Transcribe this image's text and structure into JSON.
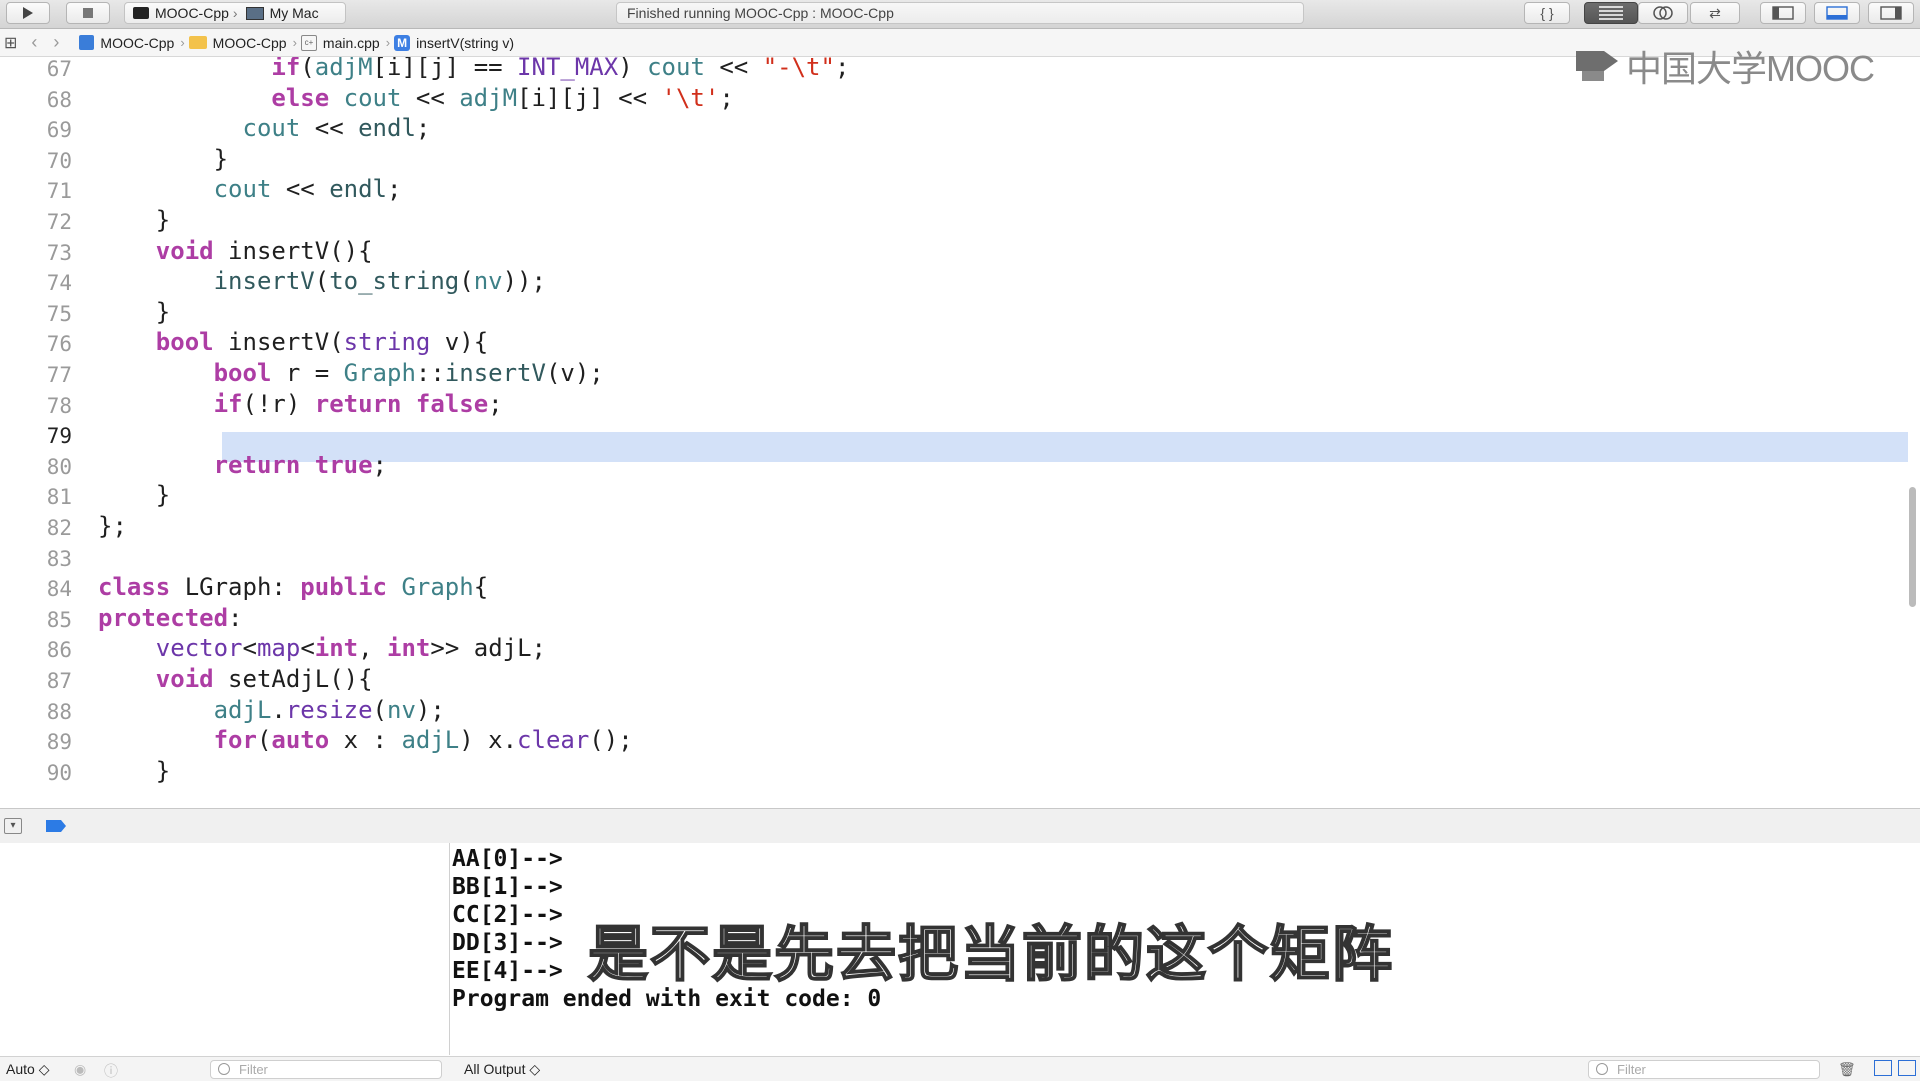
{
  "toolbar": {
    "scheme_target": "MOOC-Cpp",
    "scheme_device": "My Mac",
    "activity_status": "Finished running MOOC-Cpp : MOOC-Cpp",
    "run_icon": "play-icon",
    "stop_icon": "stop-icon"
  },
  "jumpbar": {
    "project": "MOOC-Cpp",
    "folder": "MOOC-Cpp",
    "file": "main.cpp",
    "symbol_badge": "M",
    "symbol": "insertV(string v)"
  },
  "watermark": {
    "text": "中国大学MOOC"
  },
  "editor": {
    "current_line": "79",
    "lines": [
      {
        "num": "67",
        "segs": [
          [
            "",
            "            "
          ],
          [
            "kw",
            "if"
          ],
          [
            "",
            "("
          ],
          [
            "cl",
            "adjM"
          ],
          [
            "",
            "[i][j] == "
          ],
          [
            "ty",
            "INT_MAX"
          ],
          [
            "",
            ") "
          ],
          [
            "cl",
            "cout"
          ],
          [
            "",
            " << "
          ],
          [
            "st",
            "\"-\\t\""
          ],
          [
            "",
            ";"
          ]
        ]
      },
      {
        "num": "68",
        "segs": [
          [
            "",
            "            "
          ],
          [
            "kw",
            "else"
          ],
          [
            "",
            " "
          ],
          [
            "cl",
            "cout"
          ],
          [
            "",
            " << "
          ],
          [
            "cl",
            "adjM"
          ],
          [
            "",
            "[i][j] << "
          ],
          [
            "st",
            "'\\t'"
          ],
          [
            "",
            ";"
          ]
        ]
      },
      {
        "num": "69",
        "segs": [
          [
            "",
            "          "
          ],
          [
            "cl",
            "cout"
          ],
          [
            "",
            " << "
          ],
          [
            "fn",
            "endl"
          ],
          [
            "",
            ";"
          ]
        ]
      },
      {
        "num": "70",
        "segs": [
          [
            "",
            "        }"
          ]
        ]
      },
      {
        "num": "71",
        "segs": [
          [
            "",
            "        "
          ],
          [
            "cl",
            "cout"
          ],
          [
            "",
            " << "
          ],
          [
            "fn",
            "endl"
          ],
          [
            "",
            ";"
          ]
        ]
      },
      {
        "num": "72",
        "segs": [
          [
            "",
            "    }"
          ]
        ]
      },
      {
        "num": "73",
        "segs": [
          [
            "",
            "    "
          ],
          [
            "kw",
            "void"
          ],
          [
            "",
            " insertV(){"
          ]
        ]
      },
      {
        "num": "74",
        "segs": [
          [
            "",
            "        "
          ],
          [
            "fn",
            "insertV"
          ],
          [
            "",
            "("
          ],
          [
            "fn",
            "to_string"
          ],
          [
            "",
            "("
          ],
          [
            "cl",
            "nv"
          ],
          [
            "",
            "));"
          ]
        ]
      },
      {
        "num": "75",
        "segs": [
          [
            "",
            "    }"
          ]
        ]
      },
      {
        "num": "76",
        "segs": [
          [
            "",
            "    "
          ],
          [
            "kw",
            "bool"
          ],
          [
            "",
            " insertV("
          ],
          [
            "ty",
            "string"
          ],
          [
            "",
            " v){"
          ]
        ]
      },
      {
        "num": "77",
        "segs": [
          [
            "",
            "        "
          ],
          [
            "kw",
            "bool"
          ],
          [
            "",
            " r = "
          ],
          [
            "cl",
            "Graph"
          ],
          [
            "",
            "::"
          ],
          [
            "fn",
            "insertV"
          ],
          [
            "",
            "(v);"
          ]
        ]
      },
      {
        "num": "78",
        "segs": [
          [
            "",
            "        "
          ],
          [
            "kw",
            "if"
          ],
          [
            "",
            "(!r) "
          ],
          [
            "kw",
            "return"
          ],
          [
            "",
            " "
          ],
          [
            "kw",
            "false"
          ],
          [
            "",
            ";"
          ]
        ]
      },
      {
        "num": "79",
        "segs": [
          [
            "",
            ""
          ]
        ]
      },
      {
        "num": "80",
        "segs": [
          [
            "",
            "        "
          ],
          [
            "kw",
            "return"
          ],
          [
            "",
            " "
          ],
          [
            "kw",
            "true"
          ],
          [
            "",
            ";"
          ]
        ]
      },
      {
        "num": "81",
        "segs": [
          [
            "",
            "    }"
          ]
        ]
      },
      {
        "num": "82",
        "segs": [
          [
            "",
            "};"
          ]
        ]
      },
      {
        "num": "83",
        "segs": [
          [
            "",
            ""
          ]
        ]
      },
      {
        "num": "84",
        "segs": [
          [
            "kw",
            "class"
          ],
          [
            "",
            " LGraph: "
          ],
          [
            "kw",
            "public"
          ],
          [
            "",
            " "
          ],
          [
            "cl",
            "Graph"
          ],
          [
            "",
            "{"
          ]
        ]
      },
      {
        "num": "85",
        "segs": [
          [
            "kw",
            "protected"
          ],
          [
            "",
            ":"
          ]
        ]
      },
      {
        "num": "86",
        "segs": [
          [
            "",
            "    "
          ],
          [
            "ty",
            "vector"
          ],
          [
            "",
            "<"
          ],
          [
            "ty",
            "map"
          ],
          [
            "",
            "<"
          ],
          [
            "kw",
            "int"
          ],
          [
            "",
            ", "
          ],
          [
            "kw",
            "int"
          ],
          [
            "",
            ">> adjL;"
          ]
        ]
      },
      {
        "num": "87",
        "segs": [
          [
            "",
            "    "
          ],
          [
            "kw",
            "void"
          ],
          [
            "",
            " setAdjL(){"
          ]
        ]
      },
      {
        "num": "88",
        "segs": [
          [
            "",
            "        "
          ],
          [
            "cl",
            "adjL"
          ],
          [
            "",
            "."
          ],
          [
            "ty",
            "resize"
          ],
          [
            "",
            "("
          ],
          [
            "cl",
            "nv"
          ],
          [
            "",
            ");"
          ]
        ]
      },
      {
        "num": "89",
        "segs": [
          [
            "",
            "        "
          ],
          [
            "kw",
            "for"
          ],
          [
            "",
            "("
          ],
          [
            "kw",
            "auto"
          ],
          [
            "",
            " x : "
          ],
          [
            "cl",
            "adjL"
          ],
          [
            "",
            ") x."
          ],
          [
            "ty",
            "clear"
          ],
          [
            "",
            "();"
          ]
        ]
      },
      {
        "num": "90",
        "segs": [
          [
            "",
            "    }"
          ]
        ]
      }
    ]
  },
  "console": {
    "lines": [
      "AA[0]-->",
      "BB[1]-->",
      "CC[2]-->",
      "DD[3]-->",
      "EE[4]-->",
      "Program ended with exit code: 0"
    ]
  },
  "subtitle": "是不是先去把当前的这个矩阵",
  "bottombar": {
    "auto_label": "Auto ◇",
    "left_filter_placeholder": "Filter",
    "output_label": "All Output ◇",
    "right_filter_placeholder": "Filter"
  }
}
